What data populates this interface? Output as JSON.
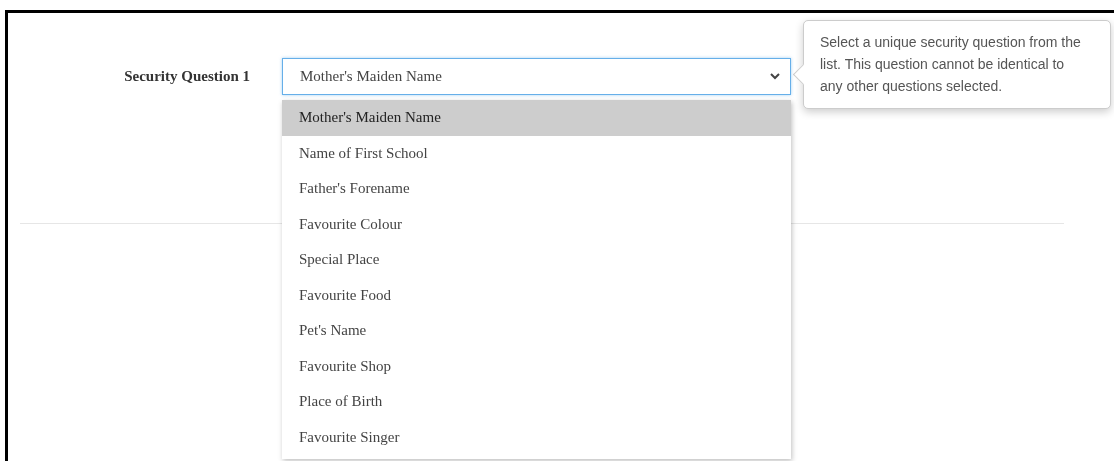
{
  "field": {
    "label": "Security Question 1",
    "value": "Mother's Maiden Name",
    "expanded": true
  },
  "options": [
    {
      "label": "Mother's Maiden Name",
      "selected": true
    },
    {
      "label": "Name of First School",
      "selected": false
    },
    {
      "label": "Father's Forename",
      "selected": false
    },
    {
      "label": "Favourite Colour",
      "selected": false
    },
    {
      "label": "Special Place",
      "selected": false
    },
    {
      "label": "Favourite Food",
      "selected": false
    },
    {
      "label": "Pet's Name",
      "selected": false
    },
    {
      "label": "Favourite Shop",
      "selected": false
    },
    {
      "label": "Place of Birth",
      "selected": false
    },
    {
      "label": "Favourite Singer",
      "selected": false
    }
  ],
  "tooltip": {
    "text": "Select a unique security question from the list. This question cannot be identical to any other questions selected."
  }
}
